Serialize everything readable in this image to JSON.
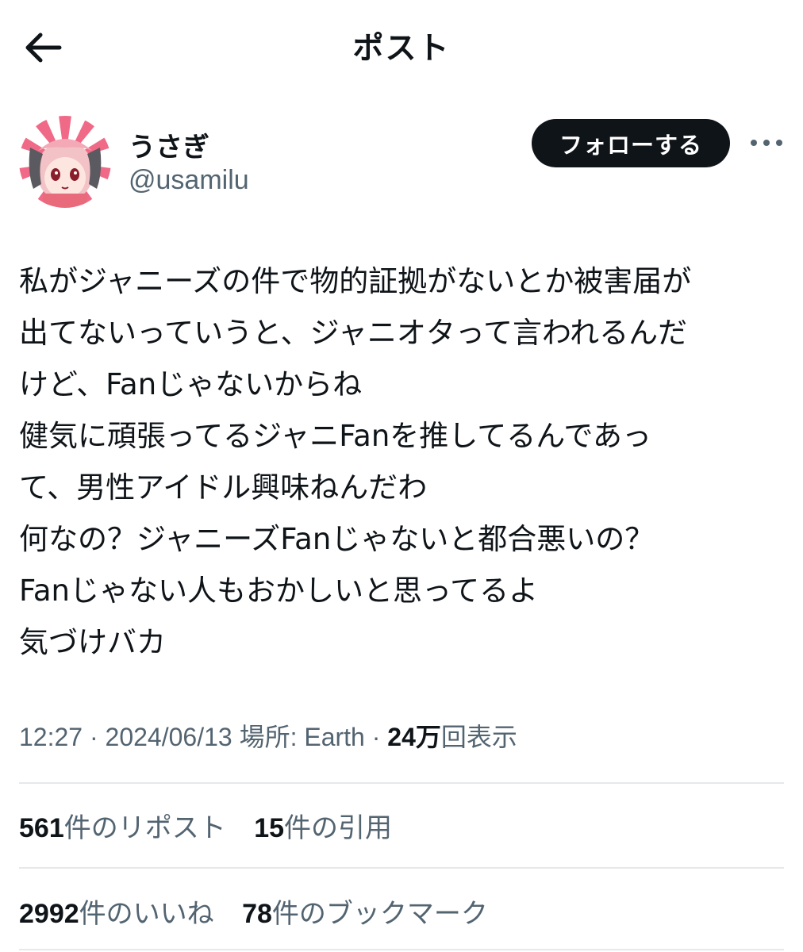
{
  "header": {
    "title": "ポスト",
    "back_icon": "arrow-left-icon"
  },
  "author": {
    "display_name": "うさぎ",
    "handle": "@usamilu",
    "follow_label": "フォローする",
    "more_icon": "more-horizontal-icon"
  },
  "tweet": {
    "lines": [
      "私がジャニーズの件で物的証拠がないとか被害届が",
      "出てないっていうと、ジャニオタって言われるんだ",
      "けど、Fanじゃないからね",
      "健気に頑張ってるジャニFanを推してるんであっ",
      "て、男性アイドル興味ねんだわ",
      "何なの？ジャニーズFanじゃないと都合悪いの？",
      "Fanじゃない人もおかしいと思ってるよ",
      "気づけバカ"
    ]
  },
  "meta": {
    "time": "12:27",
    "date": "2024/06/13",
    "location": "場所: Earth",
    "views_count": "24万",
    "views_label": "回表示"
  },
  "stats": {
    "reposts": {
      "count": "561",
      "label": "件のリポスト"
    },
    "quotes": {
      "count": "15",
      "label": "件の引用"
    },
    "likes": {
      "count": "2992",
      "label": "件のいいね"
    },
    "bookmarks": {
      "count": "78",
      "label": "件のブックマーク"
    }
  },
  "colors": {
    "text": "#0f1419",
    "secondary": "#536471",
    "button": "#0f1419"
  }
}
